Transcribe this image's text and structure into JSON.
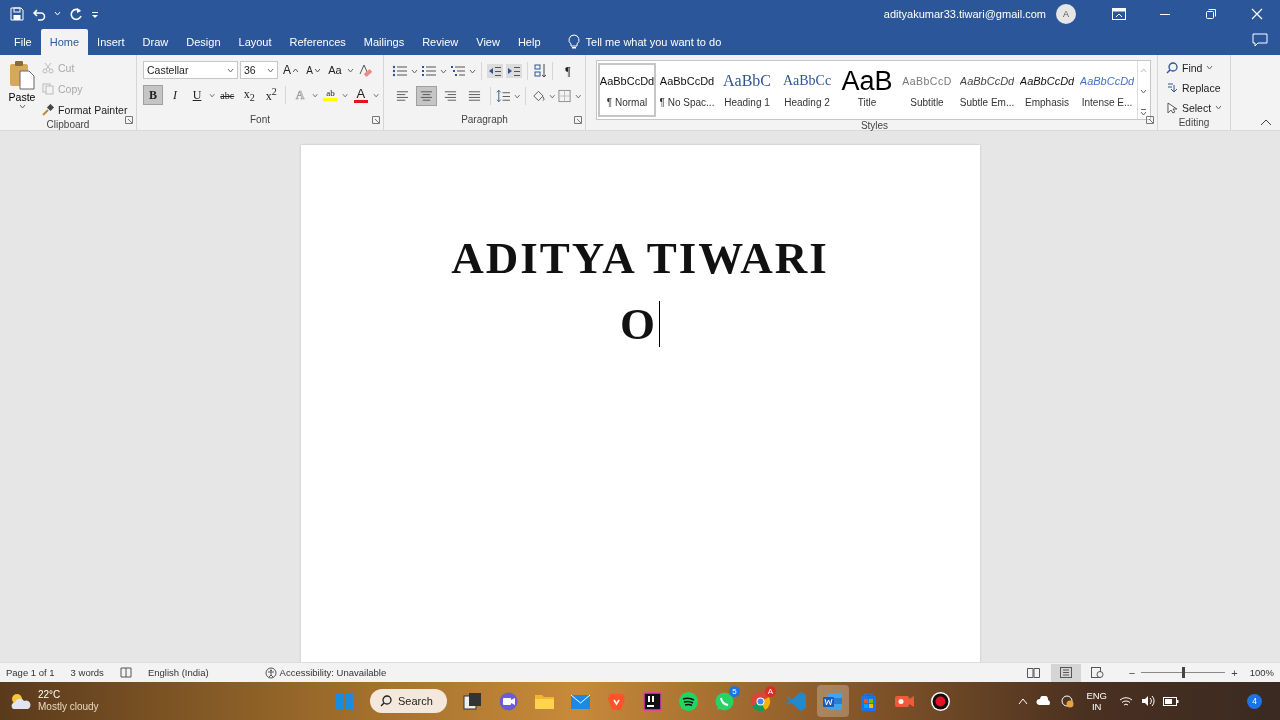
{
  "title_bar": {
    "account": "adityakumar33.tiwari@gmail.com",
    "avatar": "A"
  },
  "menu_tabs": [
    {
      "label": "File",
      "selected": false
    },
    {
      "label": "Home",
      "selected": true
    },
    {
      "label": "Insert",
      "selected": false
    },
    {
      "label": "Draw",
      "selected": false
    },
    {
      "label": "Design",
      "selected": false
    },
    {
      "label": "Layout",
      "selected": false
    },
    {
      "label": "References",
      "selected": false
    },
    {
      "label": "Mailings",
      "selected": false
    },
    {
      "label": "Review",
      "selected": false
    },
    {
      "label": "View",
      "selected": false
    },
    {
      "label": "Help",
      "selected": false
    }
  ],
  "tell_me": "Tell me what you want to do",
  "ribbon": {
    "clipboard": {
      "title": "Clipboard",
      "paste": "Paste",
      "items": [
        {
          "kind": "cut",
          "label": "Cut",
          "disabled": true
        },
        {
          "kind": "copy",
          "label": "Copy",
          "disabled": true
        },
        {
          "kind": "painter",
          "label": "Format Painter",
          "disabled": false
        }
      ]
    },
    "font": {
      "title": "Font",
      "family": "Castellar",
      "size": "36",
      "tools": [
        {
          "kind": "grow",
          "label": "A"
        },
        {
          "kind": "shrink",
          "label": "A"
        },
        {
          "kind": "case",
          "label": "Aa"
        }
      ],
      "format": [
        {
          "kind": "bold",
          "label": "B",
          "selected": true
        },
        {
          "kind": "italic",
          "label": "I",
          "selected": false
        },
        {
          "kind": "underline",
          "label": "U",
          "selected": false
        },
        {
          "kind": "strike",
          "label": "abc",
          "selected": false
        },
        {
          "kind": "sub",
          "label": "x$_{2}$",
          "selected": false
        },
        {
          "kind": "sup",
          "label": "x$^{2}$",
          "selected": false
        }
      ],
      "effects": [
        {
          "kind": "effects",
          "label": "A",
          "disabled": true
        },
        {
          "kind": "highlight",
          "label": "ab",
          "color": "#ffff00",
          "disabled": false
        },
        {
          "kind": "color",
          "label": "A",
          "color": "#e81123",
          "disabled": false
        }
      ]
    },
    "paragraph": {
      "title": "Paragraph",
      "pilcrow": "¶",
      "align": [
        {
          "kind": "left",
          "selected": false
        },
        {
          "kind": "center",
          "selected": true
        },
        {
          "kind": "right",
          "selected": false
        },
        {
          "kind": "justify",
          "selected": false
        }
      ]
    },
    "styles": {
      "title": "Styles",
      "items": [
        {
          "kind": "normal",
          "preview": "AaBbCcDd",
          "label": "¶ Normal",
          "selected": true
        },
        {
          "kind": "nospacing",
          "preview": "AaBbCcDd",
          "label": "¶ No Spac...",
          "selected": false
        },
        {
          "kind": "heading1",
          "preview": "AaBbC",
          "label": "Heading 1",
          "selected": false
        },
        {
          "kind": "heading2",
          "preview": "AaBbCc",
          "label": "Heading 2",
          "selected": false
        },
        {
          "kind": "title",
          "preview": "AaB",
          "label": "Title",
          "selected": false
        },
        {
          "kind": "subtitle",
          "preview": "AaBbCcD",
          "label": "Subtitle",
          "selected": false
        },
        {
          "kind": "subtle",
          "preview": "AaBbCcDd",
          "label": "Subtle Em...",
          "selected": false
        },
        {
          "kind": "emphasis",
          "preview": "AaBbCcDd",
          "label": "Emphasis",
          "selected": false
        },
        {
          "kind": "intense",
          "preview": "AaBbCcDd",
          "label": "Intense E...",
          "selected": false
        }
      ]
    },
    "editing": {
      "title": "Editing",
      "items": [
        {
          "kind": "find",
          "label": "Find"
        },
        {
          "kind": "replace",
          "label": "Replace"
        },
        {
          "kind": "select",
          "label": "Select"
        }
      ]
    }
  },
  "document": {
    "lines": [
      "ADITYA TIWARI",
      "O"
    ]
  },
  "status_bar": {
    "page": "Page 1 of 1",
    "words": "3 words",
    "language": "English (India)",
    "accessibility": "Accessibility: Unavailable",
    "views": [
      {
        "kind": "read",
        "selected": false
      },
      {
        "kind": "print",
        "selected": true
      },
      {
        "kind": "web",
        "selected": false
      }
    ],
    "zoom_out": "−",
    "zoom_in": "+",
    "zoom": {
      "level": 0.5
    },
    "zoom_label": "100%"
  },
  "taskbar": {
    "temperature": "22°C",
    "weather": "Mostly cloudy",
    "search": "Search",
    "apps": [
      {
        "kind": "start",
        "selected": false
      },
      {
        "kind": "taskview",
        "selected": false
      },
      {
        "kind": "meet",
        "selected": false
      },
      {
        "kind": "files",
        "selected": false
      },
      {
        "kind": "mail",
        "selected": false
      },
      {
        "kind": "brave",
        "selected": false
      },
      {
        "kind": "ide",
        "selected": false
      },
      {
        "kind": "spotify",
        "selected": false
      },
      {
        "kind": "whatsapp",
        "badge": "5",
        "selected": false
      },
      {
        "kind": "chrome",
        "badge": "A",
        "selected": false
      },
      {
        "kind": "vscode",
        "selected": false
      },
      {
        "kind": "word",
        "selected": true
      },
      {
        "kind": "store",
        "selected": false
      },
      {
        "kind": "camera",
        "selected": false
      },
      {
        "kind": "record",
        "selected": false
      }
    ],
    "language": [
      "ENG",
      "IN"
    ],
    "notifications": "4"
  }
}
